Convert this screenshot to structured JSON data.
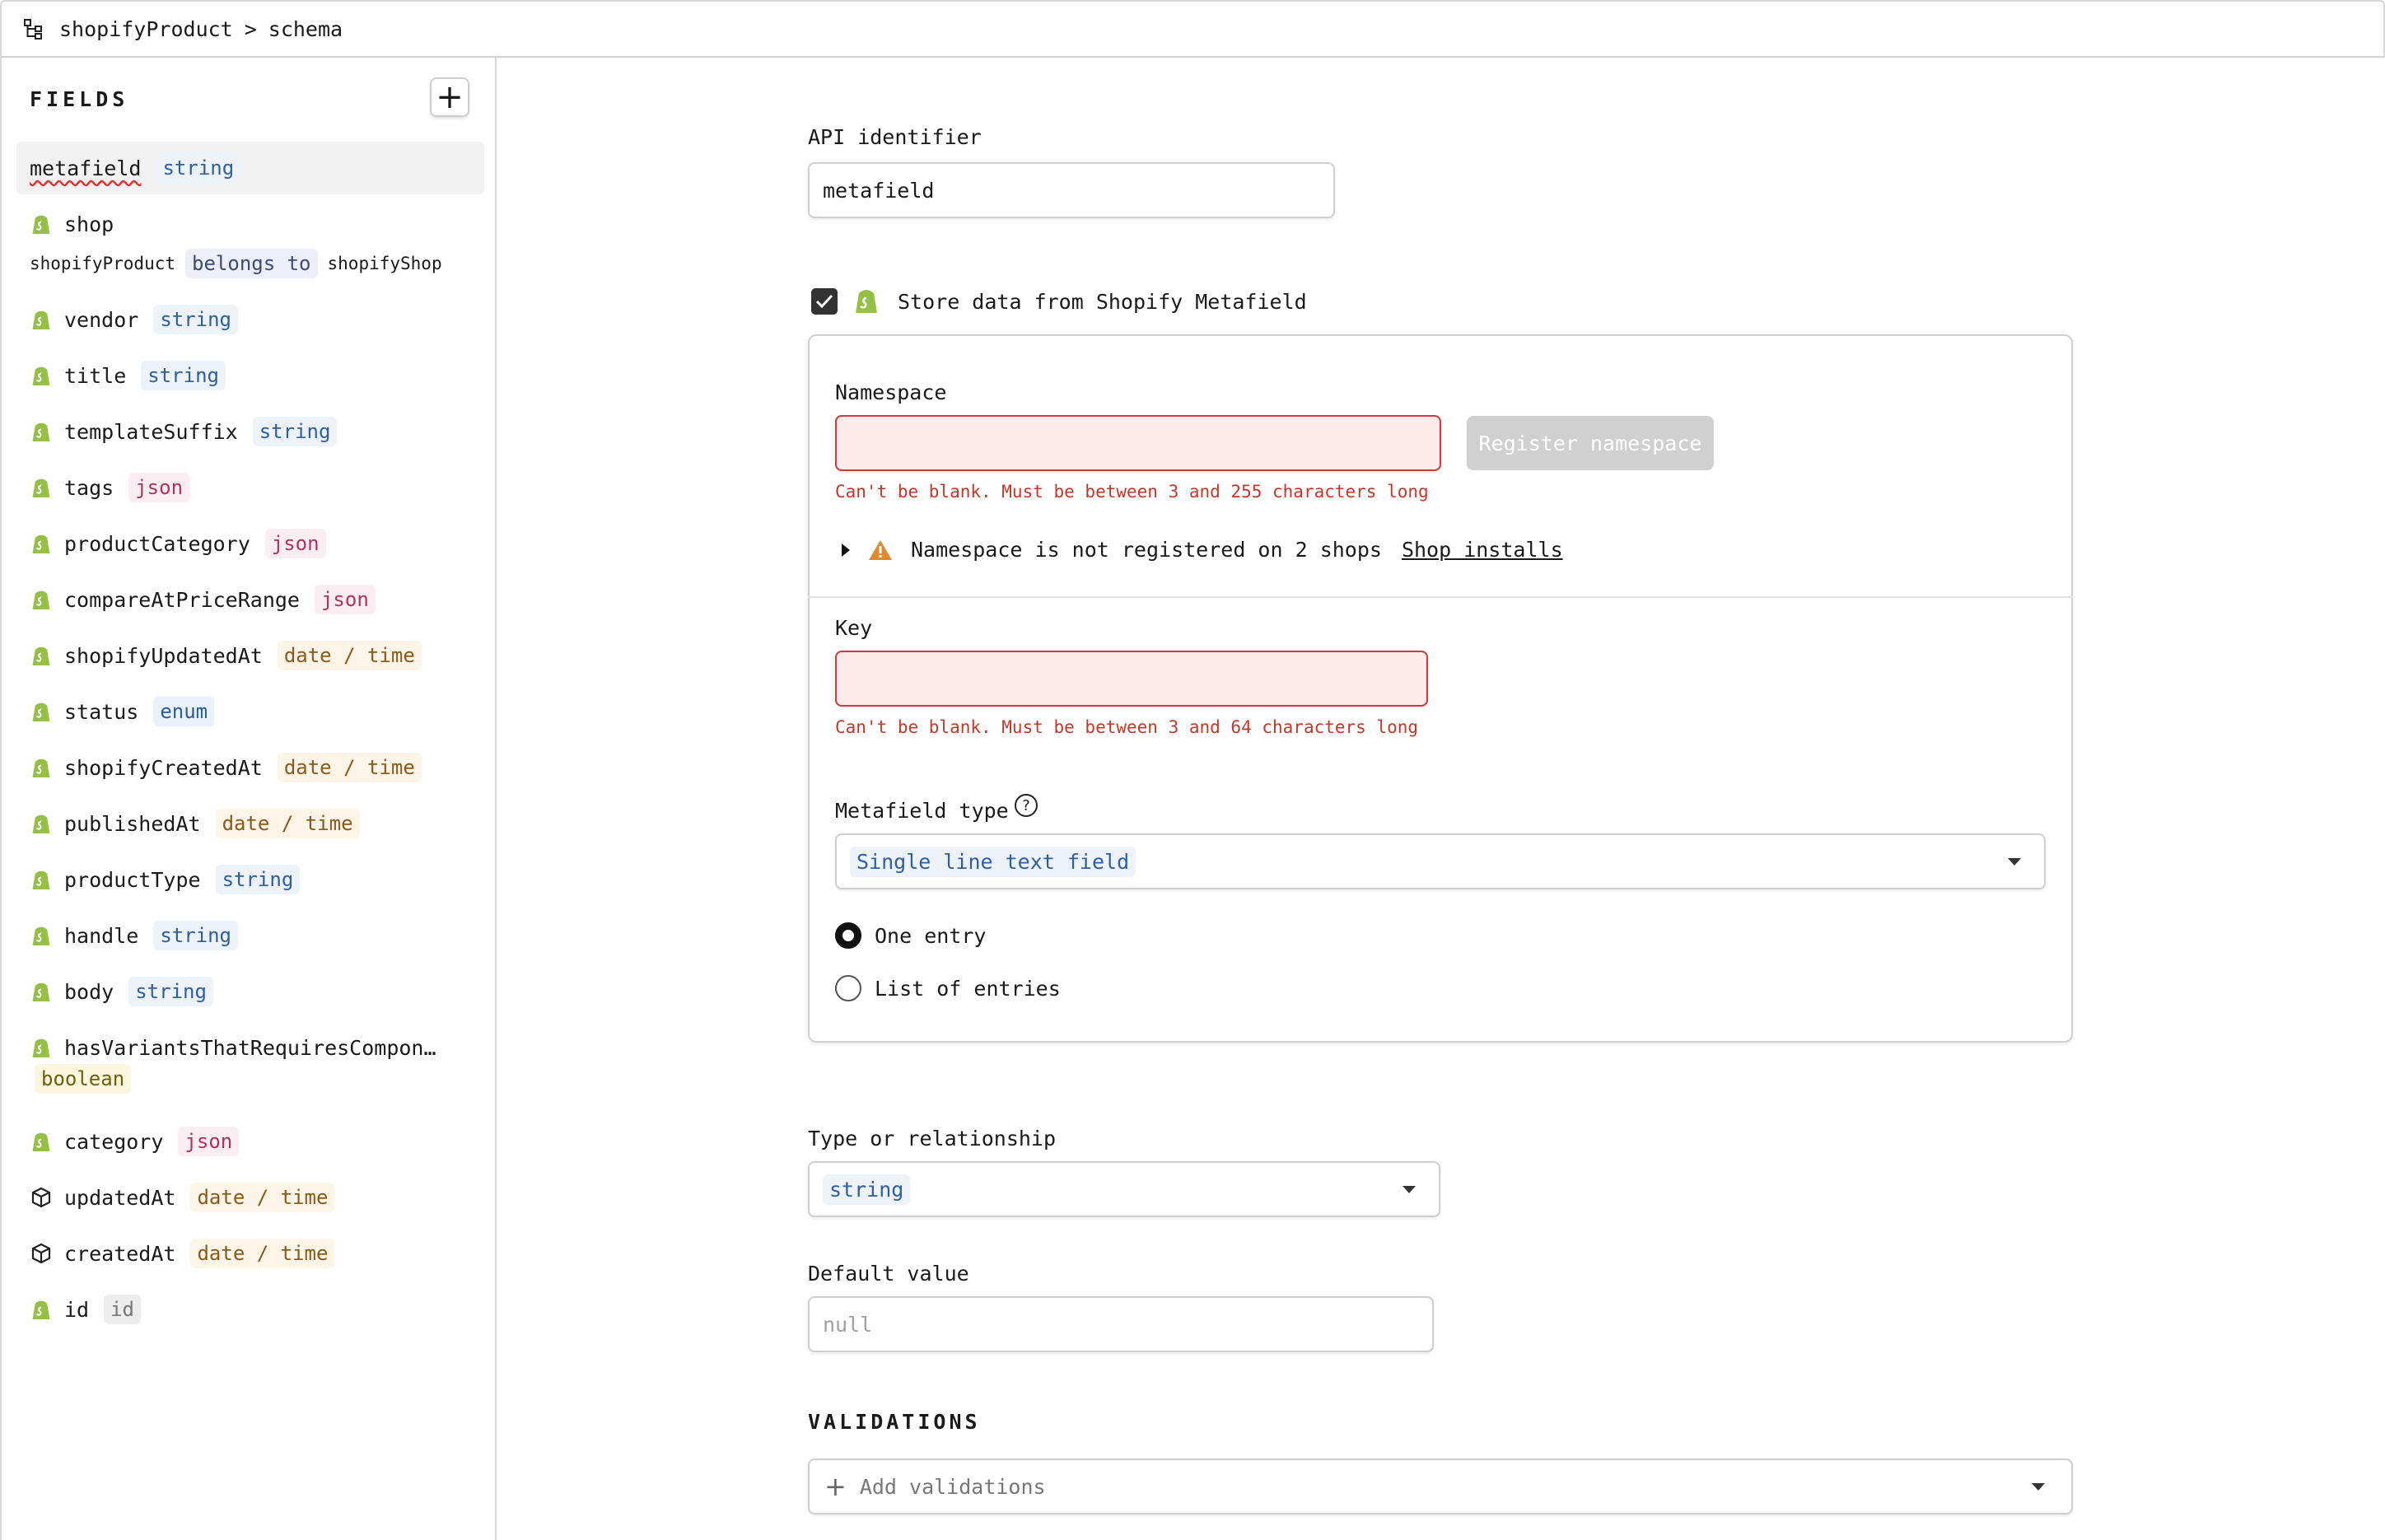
{
  "breadcrumb": {
    "model": "shopifyProduct",
    "separator": ">",
    "page": "schema"
  },
  "sidebar": {
    "heading": "FIELDS",
    "add_label": "+",
    "fields": [
      {
        "name": "metafield",
        "type": "string",
        "icon": "none",
        "selected": true
      },
      {
        "name": "shop",
        "icon": "shopify"
      },
      {
        "name": "vendor",
        "type": "string",
        "icon": "shopify"
      },
      {
        "name": "title",
        "type": "string",
        "icon": "shopify"
      },
      {
        "name": "templateSuffix",
        "type": "string",
        "icon": "shopify"
      },
      {
        "name": "tags",
        "type": "json",
        "icon": "shopify"
      },
      {
        "name": "productCategory",
        "type": "json",
        "icon": "shopify"
      },
      {
        "name": "compareAtPriceRange",
        "type": "json",
        "icon": "shopify"
      },
      {
        "name": "shopifyUpdatedAt",
        "type": "date / time",
        "icon": "shopify"
      },
      {
        "name": "status",
        "type": "enum",
        "icon": "shopify"
      },
      {
        "name": "shopifyCreatedAt",
        "type": "date / time",
        "icon": "shopify"
      },
      {
        "name": "publishedAt",
        "type": "date / time",
        "icon": "shopify"
      },
      {
        "name": "productType",
        "type": "string",
        "icon": "shopify"
      },
      {
        "name": "handle",
        "type": "string",
        "icon": "shopify"
      },
      {
        "name": "body",
        "type": "string",
        "icon": "shopify"
      },
      {
        "name": "hasVariantsThatRequiresCompon…",
        "type": "boolean",
        "icon": "shopify"
      },
      {
        "name": "category",
        "type": "json",
        "icon": "shopify"
      },
      {
        "name": "updatedAt",
        "type": "date / time",
        "icon": "cube"
      },
      {
        "name": "createdAt",
        "type": "date / time",
        "icon": "cube"
      },
      {
        "name": "id",
        "type": "id",
        "icon": "shopify"
      }
    ],
    "relationship": {
      "from": "shopifyProduct",
      "kind": "belongs to",
      "to": "shopifyShop"
    }
  },
  "main": {
    "api_identifier": {
      "label": "API identifier",
      "value": "metafield"
    },
    "store_metafield": {
      "label": "Store data from Shopify Metafield",
      "checked": true
    },
    "namespace": {
      "label": "Namespace",
      "value": "",
      "error": "Can't be blank. Must be between 3 and 255 characters long",
      "register_label": "Register namespace",
      "warning": "Namespace is not registered on 2 shops",
      "warning_link": "Shop installs"
    },
    "key": {
      "label": "Key",
      "value": "",
      "error": "Can't be blank. Must be between 3 and 64 characters long"
    },
    "metafield_type": {
      "label": "Metafield type",
      "help_icon": "?",
      "selected": "Single line text field",
      "options": [
        {
          "label": "One entry",
          "checked": true
        },
        {
          "label": "List of entries",
          "checked": false
        }
      ]
    },
    "type_relationship": {
      "label": "Type or relationship",
      "selected": "string"
    },
    "default_value": {
      "label": "Default value",
      "placeholder": "null"
    },
    "validations": {
      "heading": "VALIDATIONS",
      "add_label": "Add validations"
    }
  },
  "colors": {
    "error": "#c0392b",
    "error_bg": "#fcebea",
    "shopify_green": "#95bf47",
    "string_tag": "#2f5f9e",
    "json_tag": "#b0335f",
    "date_tag": "#8a5a1a"
  }
}
